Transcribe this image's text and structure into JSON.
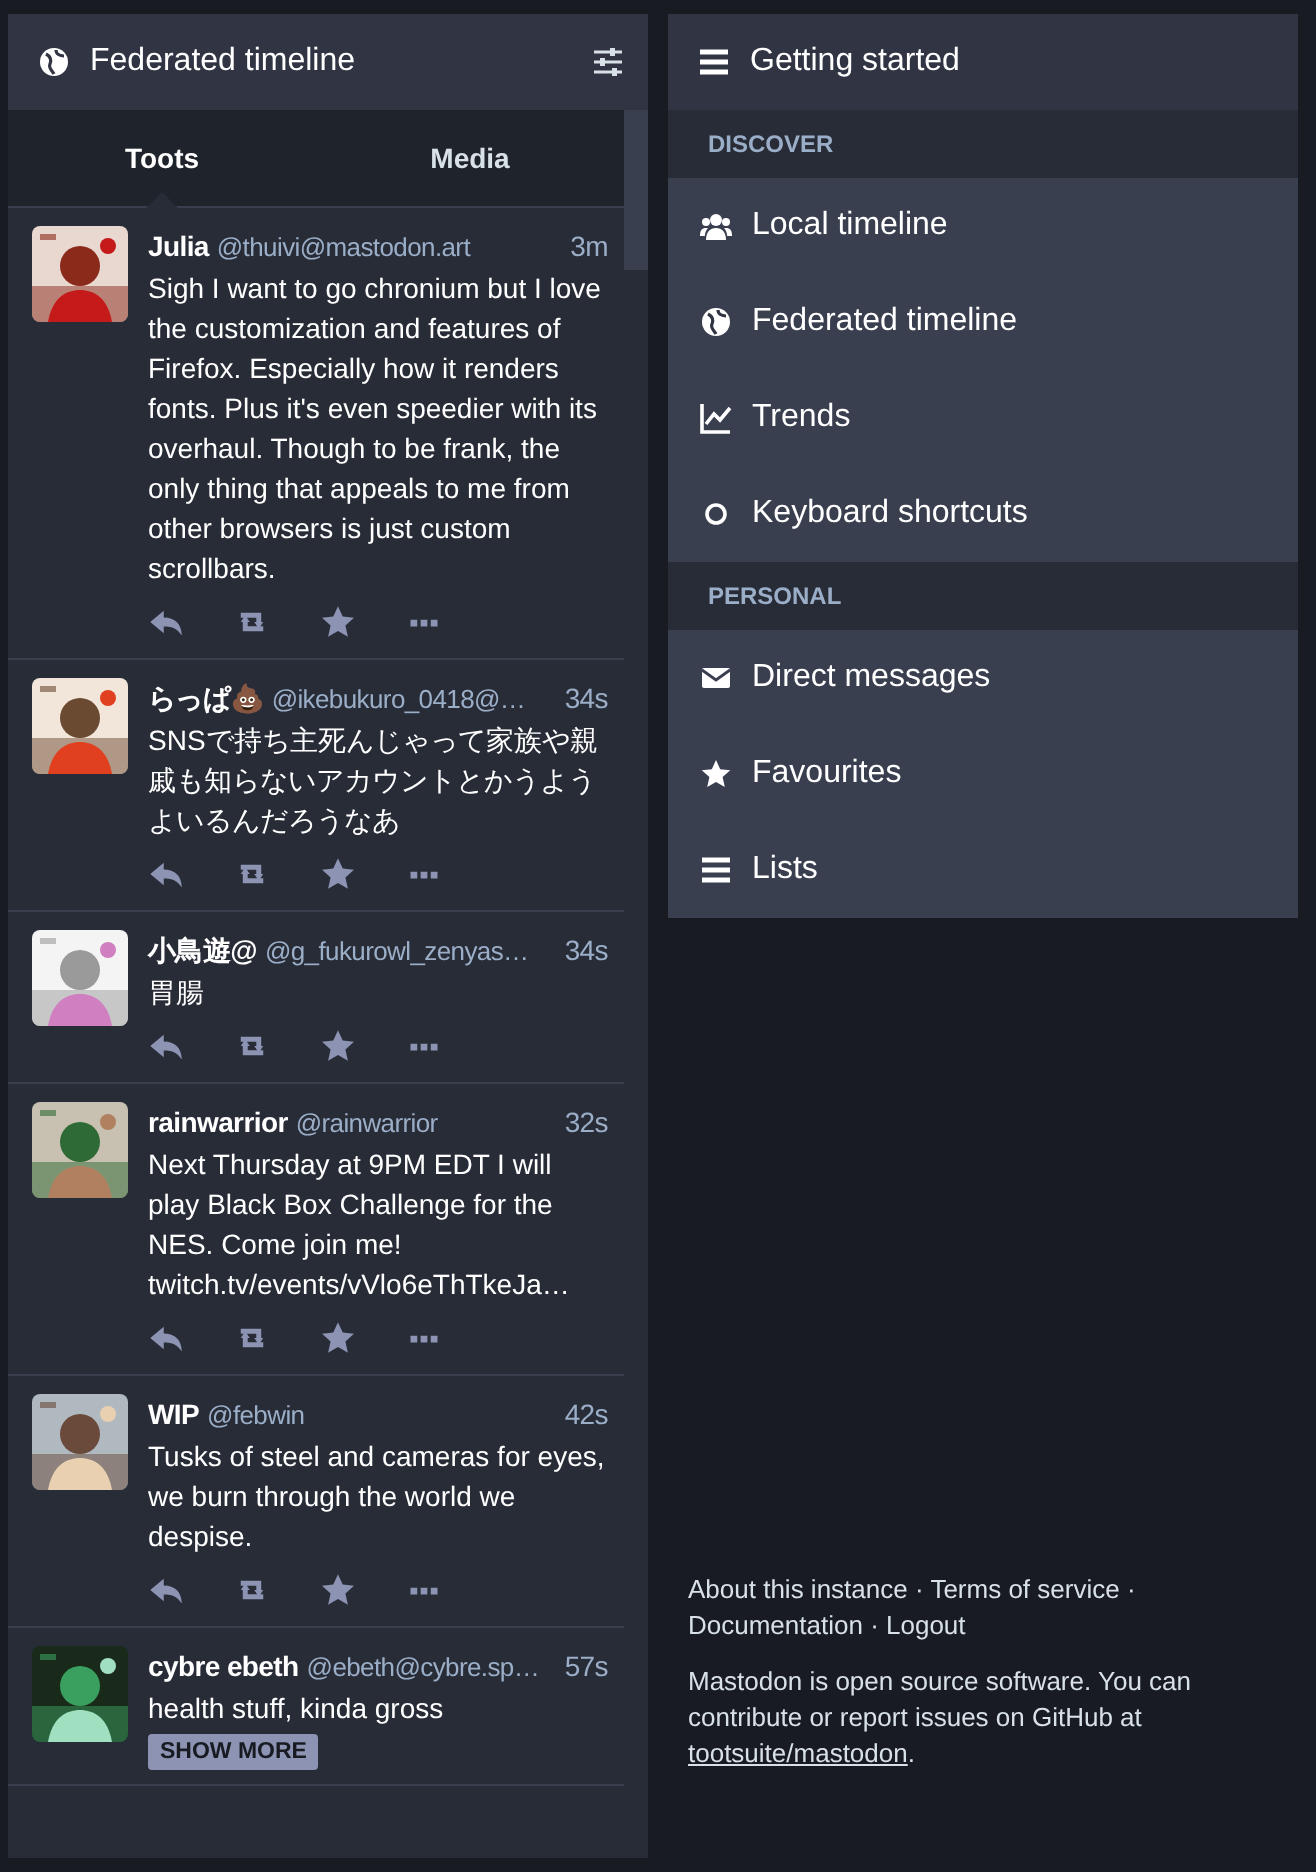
{
  "timeline": {
    "title": "Federated timeline",
    "tabs": [
      {
        "label": "Toots",
        "selected": true
      },
      {
        "label": "Media",
        "selected": false
      }
    ],
    "posts": [
      {
        "name": "Julia",
        "handle": "@thuivi@mastodon.art",
        "time": "3m",
        "content": "Sigh I want to go chronium but I love the customization and features of Firefox. Especially how it renders fonts. Plus it's even speedier with its overhaul. Though to be frank, the only thing that appeals to me from other browsers is just custom scrollbars."
      },
      {
        "name": "らっぱ💩",
        "handle": "@ikebukuro_0418@…",
        "time": "34s",
        "content": "SNSで持ち主死んじゃって家族や親戚も知らないアカウントとかうようよいるんだろうなあ"
      },
      {
        "name": "小鳥遊@",
        "handle": "@g_fukurowl_zenyas…",
        "time": "34s",
        "content": "胃腸"
      },
      {
        "name": "rainwarrior",
        "handle": "@rainwarrior",
        "time": "32s",
        "content": "Next Thursday at 9PM EDT I will play Black Box Challenge for the NES. Come join me!",
        "link": "twitch.tv/events/vVlo6eThTkeJa…"
      },
      {
        "name": "WIP",
        "handle": "@febwin",
        "time": "42s",
        "content": "Tusks of steel and cameras for eyes, we burn through the world we despise."
      },
      {
        "name": "cybre ebeth",
        "handle": "@ebeth@cybre.sp…",
        "time": "57s",
        "content": "health stuff, kinda gross",
        "spoiler_button": "SHOW MORE"
      }
    ]
  },
  "menu": {
    "title": "Getting started",
    "sections": [
      {
        "label": "DISCOVER",
        "items": [
          "Local timeline",
          "Federated timeline",
          "Trends",
          "Keyboard shortcuts"
        ]
      },
      {
        "label": "PERSONAL",
        "items": [
          "Direct messages",
          "Favourites",
          "Lists"
        ]
      }
    ]
  },
  "footer": {
    "links": [
      "About this instance",
      "Terms of service",
      "Documentation",
      "Logout"
    ],
    "separator": "·",
    "about_text": "Mastodon is open source software. You can contribute or report issues on GitHub at",
    "about_link": "tootsuite/mastodon",
    "about_end": "."
  }
}
